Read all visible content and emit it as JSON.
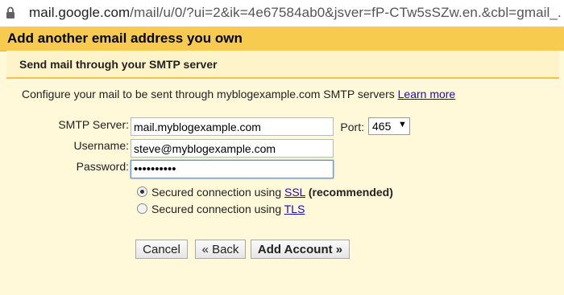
{
  "browser": {
    "url_host": "mail.google.com",
    "url_path": "/mail/u/0/?ui=2&ik=4e67584ab0&jsver=fP-CTw5sSZw.en.&cbl=gmail_..."
  },
  "dialog": {
    "title": "Add another email address you own",
    "subtitle": "Send mail through your SMTP server",
    "description": "Configure your mail to be sent through myblogexample.com SMTP servers",
    "learn_more": "Learn more"
  },
  "form": {
    "smtp_label": "SMTP Server:",
    "smtp_value": "mail.myblogexample.com",
    "port_label": "Port:",
    "port_value": "465",
    "username_label": "Username:",
    "username_value": "steve@myblogexample.com",
    "password_label": "Password:",
    "password_value": "••••••••••"
  },
  "security": {
    "option_ssl_prefix": "Secured connection using",
    "option_ssl_link": "SSL",
    "option_ssl_suffix": "(recommended)",
    "option_tls_prefix": "Secured connection using",
    "option_tls_link": "TLS",
    "selected": "SSL"
  },
  "buttons": {
    "cancel": "Cancel",
    "back": "« Back",
    "add_account": "Add Account »"
  },
  "colors": {
    "title_bar": "#f7cc4e",
    "panel_bg": "#fff8d9",
    "link": "#1a0dab"
  },
  "icons": {
    "lock": "lock-icon",
    "dropdown": "chevron-down-icon"
  }
}
